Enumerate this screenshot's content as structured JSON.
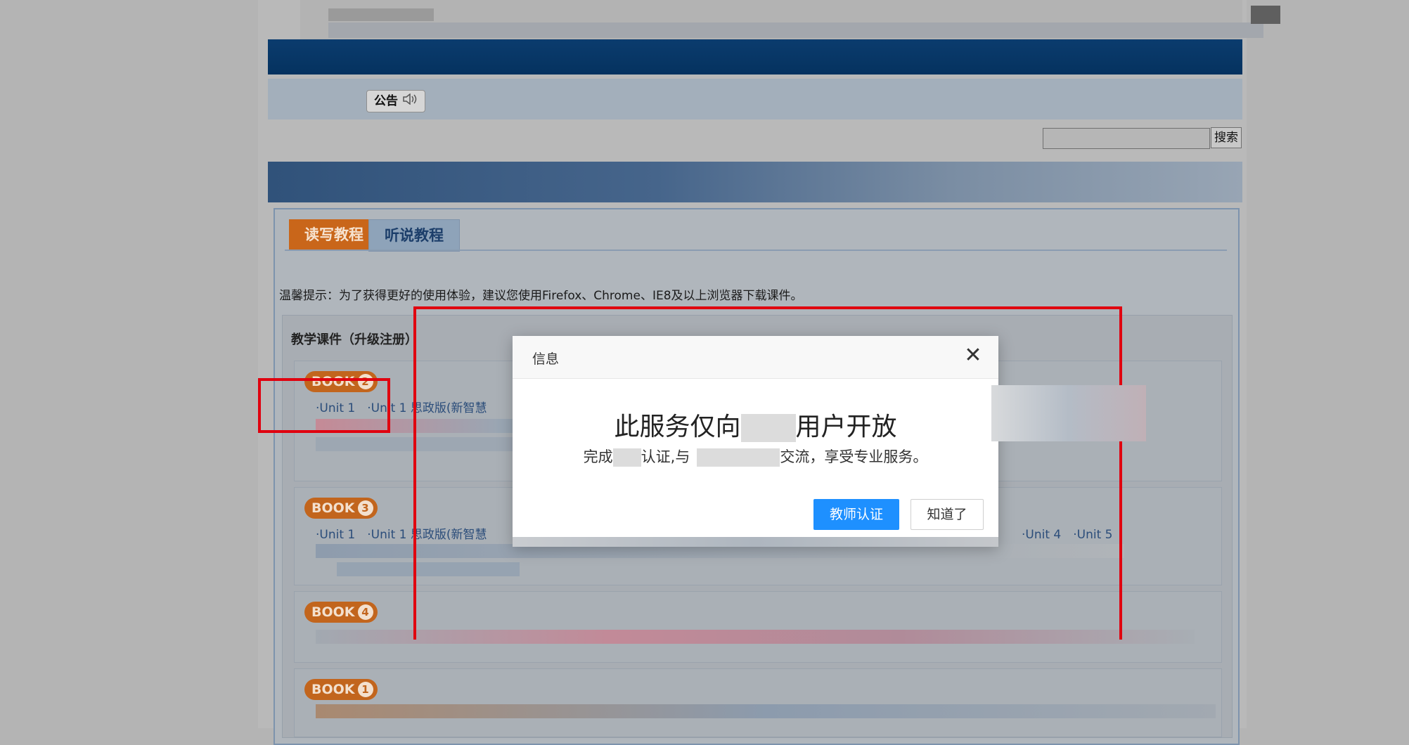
{
  "notice": {
    "label": "公告",
    "icon": "speaker-icon"
  },
  "search": {
    "placeholder": "",
    "button_label": "搜索"
  },
  "tabs": [
    {
      "label": "读写教程",
      "active": true
    },
    {
      "label": "听说教程",
      "active": false
    }
  ],
  "tip": "温馨提示：为了获得更好的使用体验，建议您使用Firefox、Chrome、IE8及以上浏览器下载课件。",
  "panel_title": "教学课件（升级注册）",
  "books": [
    {
      "label": "BOOK",
      "number": "2",
      "units": "·Unit 1　·Unit 1 思政版(新智慧"
    },
    {
      "label": "BOOK",
      "number": "3",
      "units": "·Unit 1　·Unit 1 思政版(新智慧",
      "units_right": "·Unit 4　·Unit 5"
    },
    {
      "label": "BOOK",
      "number": "4",
      "units": ""
    },
    {
      "label": "BOOK",
      "number": "1",
      "units": ""
    }
  ],
  "modal": {
    "title": "信息",
    "close_icon": "close-icon",
    "heading_prefix": "此服务仅向",
    "heading_suffix": "用户开放",
    "sub_prefix": "完成",
    "sub_middle": "认证,与",
    "sub_suffix": "交流，享受专业服务。",
    "primary_label": "教师认证",
    "secondary_label": "知道了"
  },
  "colors": {
    "banner": "#05325f",
    "tab_active": "#c9661a",
    "book_badge": "#c2651d",
    "primary_button": "#1e90ff",
    "highlight_box": "#e0000f"
  }
}
